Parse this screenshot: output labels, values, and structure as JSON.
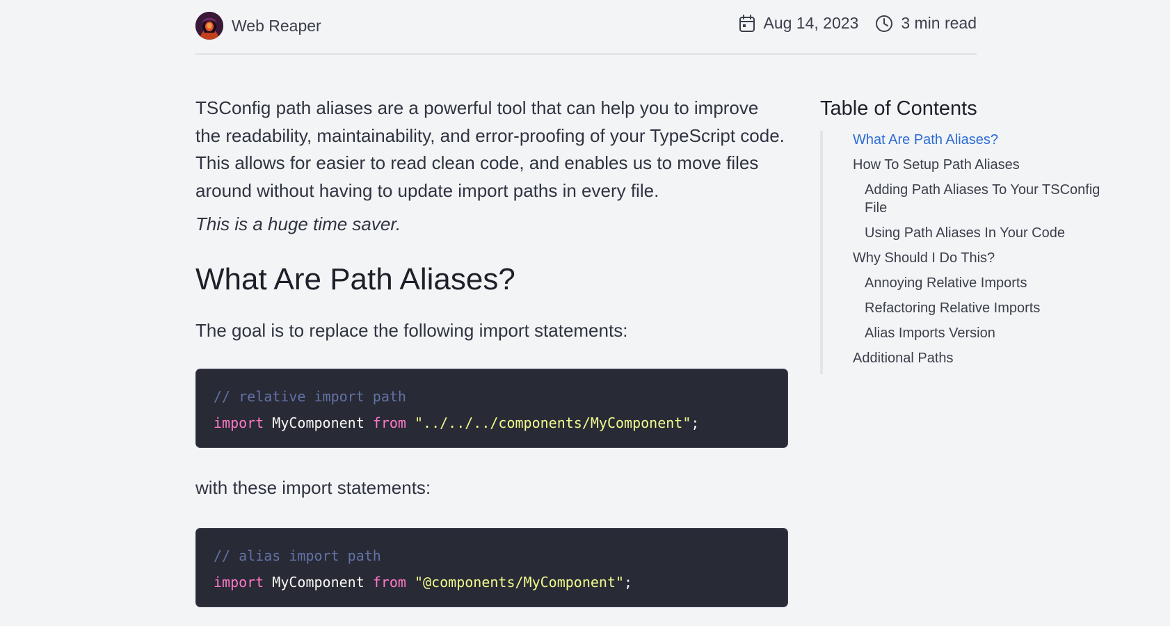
{
  "header": {
    "author_name": "Web Reaper",
    "date": "Aug 14, 2023",
    "read_time": "3 min read"
  },
  "article": {
    "intro": "TSConfig path aliases are a powerful tool that can help you to improve the readability, maintainability, and error-proofing of your TypeScript code. This allows for easier to read clean code, and enables us to move files around without having to update import paths in every file.",
    "tagline": "This is a huge time saver.",
    "heading": "What Are Path Aliases?",
    "goal_text": "The goal is to replace the following import statements:",
    "code_block_1": {
      "comment": "// relative import path",
      "keyword_import": "import",
      "identifier": "MyComponent",
      "keyword_from": "from",
      "string": "\"../../../components/MyComponent\"",
      "terminator": ";"
    },
    "with_text": "with these import statements:",
    "code_block_2": {
      "comment": "// alias import path",
      "keyword_import": "import",
      "identifier": "MyComponent",
      "keyword_from": "from",
      "string": "\"@components/MyComponent\"",
      "terminator": ";"
    }
  },
  "toc": {
    "title": "Table of Contents",
    "items": [
      {
        "label": "What Are Path Aliases?",
        "level": 1,
        "active": true
      },
      {
        "label": "How To Setup Path Aliases",
        "level": 1,
        "active": false
      },
      {
        "label": "Adding Path Aliases To Your TSConfig File",
        "level": 2,
        "active": false
      },
      {
        "label": "Using Path Aliases In Your Code",
        "level": 2,
        "active": false
      },
      {
        "label": "Why Should I Do This?",
        "level": 1,
        "active": false
      },
      {
        "label": "Annoying Relative Imports",
        "level": 2,
        "active": false
      },
      {
        "label": "Refactoring Relative Imports",
        "level": 2,
        "active": false
      },
      {
        "label": "Alias Imports Version",
        "level": 2,
        "active": false
      },
      {
        "label": "Additional Paths",
        "level": 1,
        "active": false
      }
    ]
  },
  "icons": {
    "date": "calendar-icon",
    "read_time": "clock-icon"
  },
  "colors": {
    "background": "#f3f4f6",
    "toc_active": "#2b6cd4",
    "code_background": "#282a36",
    "code_comment": "#6272a4",
    "code_keyword": "#ff79c6",
    "code_string": "#f1fa8c"
  }
}
